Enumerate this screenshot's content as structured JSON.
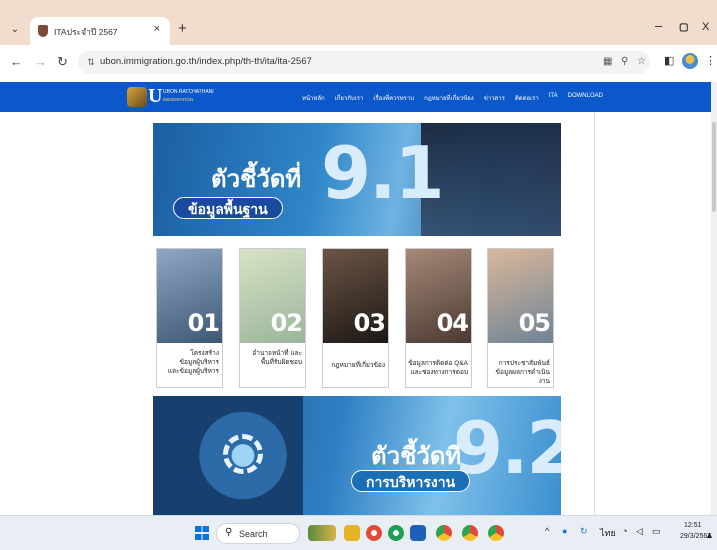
{
  "browser": {
    "tab_title": "ITAประจำปี 2567",
    "tab_close": "×",
    "new_tab": "+",
    "tab_menu": "⌄",
    "url": "ubon.immigration.go.th/index.php/th-th/ita/ita-2567",
    "window_minimize": "–",
    "window_maximize": "▢",
    "window_close": "X"
  },
  "site": {
    "logo_letter": "U",
    "logo_line1": "UBON RATCHATHANI",
    "logo_line2": "IMMIGRATION",
    "nav": [
      "หน้าหลัก",
      "เกี่ยวกับเรา",
      "เรื่องที่ควรทราบ",
      "กฎหมายที่เกี่ยวข้อง",
      "ข่าวสาร",
      "ติดต่อเรา",
      "ITA",
      "DOWNLOAD"
    ]
  },
  "banner1": {
    "heading": "ตัวชี้วัดที่",
    "number": "9.1",
    "pill": "ข้อมูลพื้นฐาน"
  },
  "cards": [
    {
      "num": "01",
      "caption": "โครงสร้าง ข้อมูลผู้บริหาร อำนาจหน้าที่ และข้อมูลผู้บริหาร",
      "caption_short": "โครงสร้าง\nข้อมูลผู้บริหาร\nและข้อมูลผู้บริหาร",
      "color": "#4f6a86"
    },
    {
      "num": "02",
      "caption": "อำนาจหน้าที่ และพื้นที่รับผิดชอบ",
      "color": "#a8bfa8"
    },
    {
      "num": "03",
      "caption": "กฎหมายที่เกี่ยวข้อง",
      "color": "#3b2f2a"
    },
    {
      "num": "04",
      "caption": "ข้อมูลการติดต่อ Q&A และช่องทางการตอบ",
      "color": "#6d5348"
    },
    {
      "num": "05",
      "caption": "การประชาสัมพันธ์ ข้อมูลผลการดำเนินงาน",
      "color": "#8c9aa6"
    }
  ],
  "banner2": {
    "heading": "ตัวชี้วัดที่",
    "number": "9.2",
    "pill": "การบริหารงาน"
  },
  "taskbar": {
    "search_placeholder": "Search",
    "tray_lang": "ไทย",
    "clock_time": "12:51",
    "clock_date": "29/3/2567"
  },
  "colors": {
    "site_header": "#0a58c9",
    "tab_strip": "#f2dccd"
  }
}
